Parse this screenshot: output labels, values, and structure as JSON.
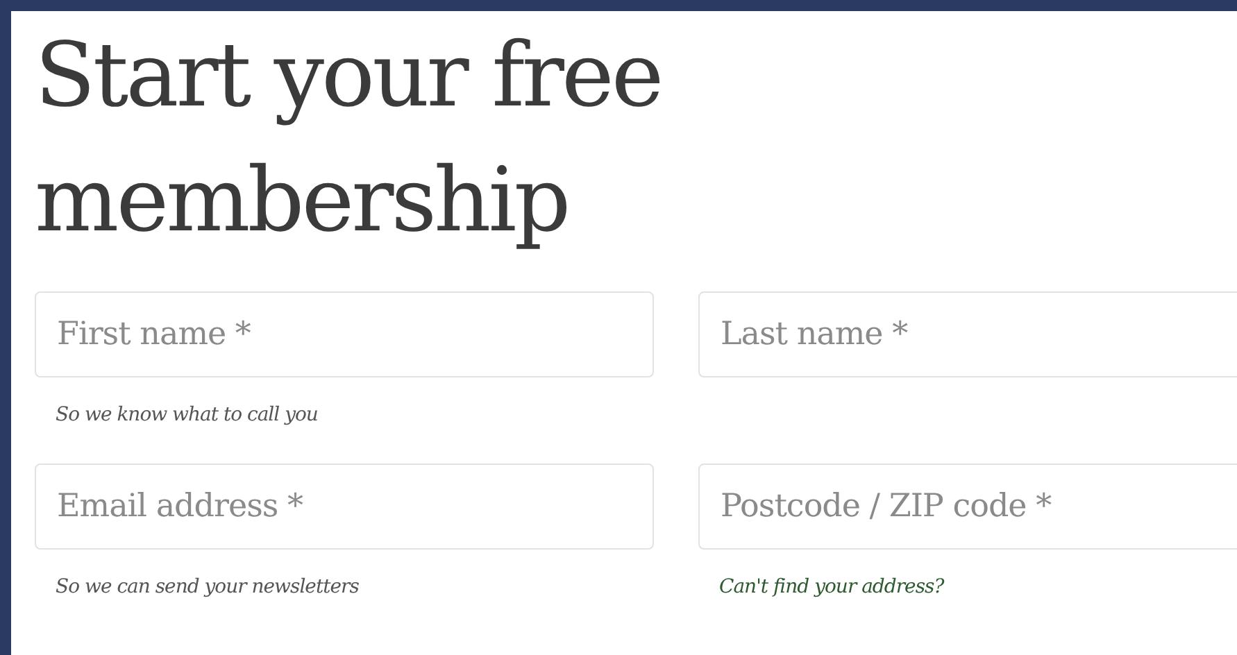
{
  "title": "Start your free membership",
  "fields": [
    {
      "placeholder": "First name *",
      "hint": {
        "kind": "text",
        "text": "So we know what to call you"
      }
    },
    {
      "placeholder": "Last name *"
    },
    {
      "placeholder": "Email address *",
      "hint": {
        "kind": "text",
        "text": "So we can send your newsletters"
      }
    },
    {
      "placeholder": "Postcode / ZIP code *",
      "hint": {
        "kind": "link",
        "text": "Can't find your address?"
      }
    }
  ]
}
